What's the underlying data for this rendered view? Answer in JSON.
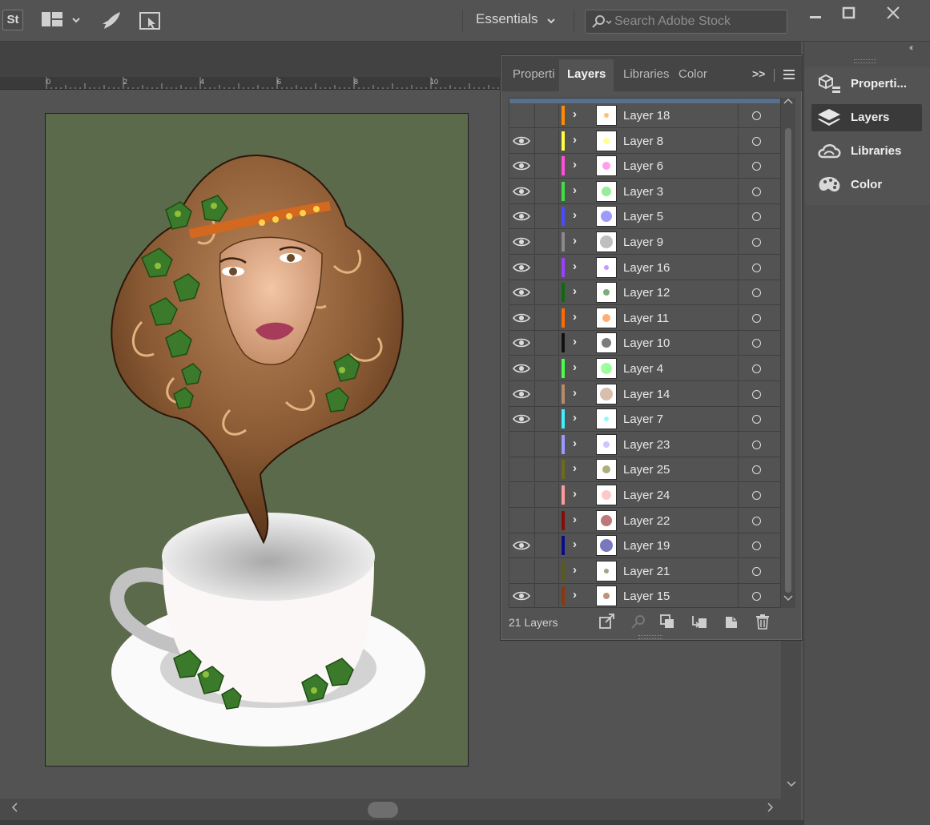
{
  "appbar": {
    "logo_text": "St",
    "workspace_label": "Essentials",
    "search_placeholder": "Search Adobe Stock",
    "icons": [
      "stock-logo-icon",
      "workspace-grid-icon",
      "gpu-performance-icon",
      "touch-workspace-icon",
      "minimize-icon",
      "maximize-icon",
      "close-icon"
    ]
  },
  "ruler": {
    "labels": [
      "0",
      "2",
      "4",
      "6",
      "8",
      "10"
    ]
  },
  "panel": {
    "tabs": [
      "Properti",
      "Layers",
      "Libraries",
      "Color"
    ],
    "active_tab": "Layers",
    "more_label": ">>",
    "footer_count": "21 Layers",
    "footer_icons": [
      "collect-for-export-icon",
      "locate-object-icon",
      "make-clipping-mask-icon",
      "create-sublayer-icon",
      "create-new-layer-icon",
      "delete-layer-icon"
    ]
  },
  "layers": [
    {
      "name": "Layer 18",
      "visible": false,
      "color": "#ff8c00"
    },
    {
      "name": "Layer 8",
      "visible": true,
      "color": "#ffff40"
    },
    {
      "name": "Layer 6",
      "visible": true,
      "color": "#ff4fd8"
    },
    {
      "name": "Layer 3",
      "visible": true,
      "color": "#40e040"
    },
    {
      "name": "Layer 5",
      "visible": true,
      "color": "#4a4aff"
    },
    {
      "name": "Layer 9",
      "visible": true,
      "color": "#8a8a8a"
    },
    {
      "name": "Layer 16",
      "visible": true,
      "color": "#9a40ff"
    },
    {
      "name": "Layer 12",
      "visible": true,
      "color": "#0e6a0e"
    },
    {
      "name": "Layer 11",
      "visible": true,
      "color": "#ff6a00"
    },
    {
      "name": "Layer 10",
      "visible": true,
      "color": "#111111"
    },
    {
      "name": "Layer 4",
      "visible": true,
      "color": "#4aff4a"
    },
    {
      "name": "Layer 14",
      "visible": true,
      "color": "#b88a6a"
    },
    {
      "name": "Layer 7",
      "visible": true,
      "color": "#40f0ff"
    },
    {
      "name": "Layer 23",
      "visible": false,
      "color": "#9a9aff"
    },
    {
      "name": "Layer 25",
      "visible": false,
      "color": "#6b6b1a"
    },
    {
      "name": "Layer 24",
      "visible": false,
      "color": "#ff9a9a"
    },
    {
      "name": "Layer 22",
      "visible": false,
      "color": "#8a0a0a"
    },
    {
      "name": "Layer 19",
      "visible": true,
      "color": "#0a0a8a"
    },
    {
      "name": "Layer 21",
      "visible": false,
      "color": "#5a5a1a"
    },
    {
      "name": "Layer 15",
      "visible": true,
      "color": "#8a3a0a"
    }
  ],
  "dock": {
    "items": [
      {
        "label": "Properti...",
        "icon": "properties-icon",
        "active": false
      },
      {
        "label": "Layers",
        "icon": "layers-icon",
        "active": true
      },
      {
        "label": "Libraries",
        "icon": "libraries-icon",
        "active": false
      },
      {
        "label": "Color",
        "icon": "color-palette-icon",
        "active": false
      }
    ]
  },
  "colors": {
    "artboard_bg": "#5c6a4c",
    "ui_bg": "#535353",
    "selection_bar": "#58708c"
  }
}
